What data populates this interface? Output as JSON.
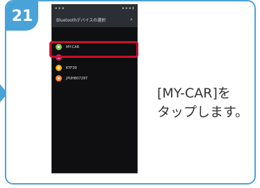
{
  "step": {
    "number": "21"
  },
  "phone": {
    "screen_title": "Bluetoothデバイスの選択",
    "search_icon": "search-icon",
    "devices": [
      {
        "name": "MY-CAR",
        "icon_color": "#8bc34a"
      },
      {
        "name": "",
        "icon_color": "#e91e63"
      },
      {
        "name": "KYF39",
        "icon_color": "#ffb300"
      },
      {
        "name": "JPUH807297",
        "icon_color": "#ff8a3d"
      }
    ]
  },
  "instruction": {
    "line1": "[MY-CAR]を",
    "line2": "タップします。"
  },
  "colors": {
    "accent": "#4aa3d8",
    "highlight": "#c8102e"
  }
}
